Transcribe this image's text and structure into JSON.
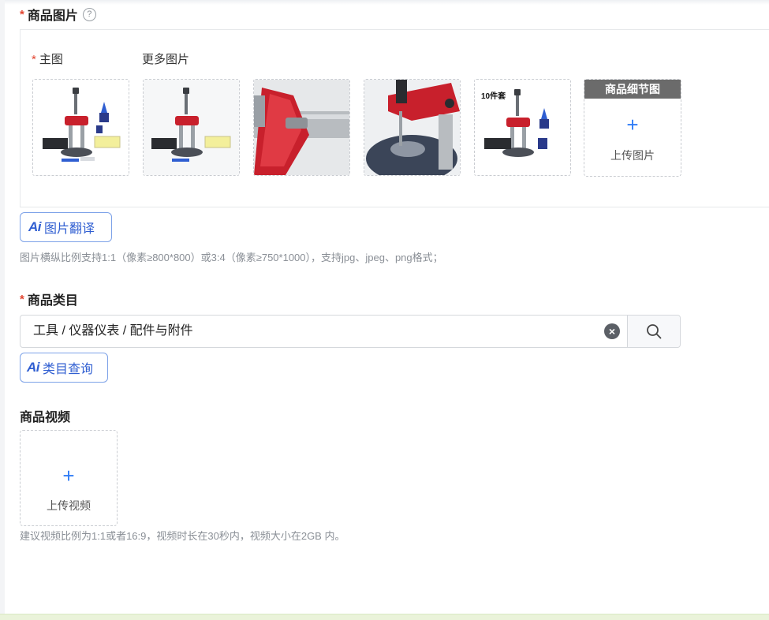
{
  "product_images": {
    "label": "商品图片",
    "help_icon": "question-circle-icon",
    "main_label": "主图",
    "more_label": "更多图片",
    "thumbnails": [
      {
        "name": "main-image",
        "badge": ""
      },
      {
        "name": "more-image-1",
        "badge": ""
      },
      {
        "name": "more-image-2",
        "badge": ""
      },
      {
        "name": "more-image-3",
        "badge": ""
      },
      {
        "name": "more-image-4",
        "badge": "10件套"
      }
    ],
    "detail_upload": {
      "tag": "商品细节图",
      "plus": "+",
      "text": "上传图片"
    },
    "ai_translate_label": "图片翻译",
    "ai_logo": "Ai",
    "hint": "图片横纵比例支持1:1（像素≥800*800）或3:4（像素≥750*1000），支持jpg、jpeg、png格式；"
  },
  "category": {
    "label": "商品类目",
    "value": "工具 / 仪器仪表 / 配件与附件",
    "ai_query_label": "类目查询",
    "ai_logo": "Ai"
  },
  "video": {
    "label": "商品视频",
    "plus": "+",
    "upload_text": "上传视频",
    "hint": "建议视频比例为1:1或者16:9，视频时长在30秒内，视频大小在2GB 内。"
  },
  "required_mark": "*",
  "colors": {
    "accent": "#2f7cf6",
    "required": "#e2442f",
    "product_red": "#d21f2d"
  }
}
